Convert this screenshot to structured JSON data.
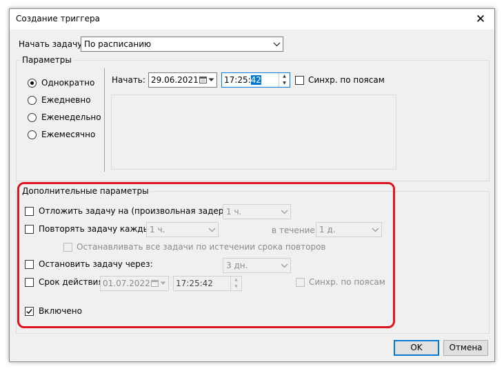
{
  "dialog": {
    "title": "Создание триггера",
    "close_glyph": "✕"
  },
  "start_task": {
    "label": "Начать задачу:",
    "value": "По расписанию"
  },
  "parameters": {
    "group_title": "Параметры",
    "options": [
      {
        "label": "Однократно",
        "selected": true
      },
      {
        "label": "Ежедневно",
        "selected": false
      },
      {
        "label": "Еженедельно",
        "selected": false
      },
      {
        "label": "Ежемесячно",
        "selected": false
      }
    ],
    "start_label": "Начать:",
    "start_date": "29.06.2021",
    "start_time_prefix": "17:25:",
    "start_time_selected": "42",
    "sync_label": "Синхр. по поясам"
  },
  "advanced": {
    "group_title": "Дополнительные параметры",
    "delay": {
      "label": "Отложить задачу на (произвольная задержка):",
      "value": "1 ч.",
      "checked": false
    },
    "repeat": {
      "label": "Повторять задачу каждые:",
      "value": "1 ч.",
      "duration_label": "в течение:",
      "duration_value": "1 д.",
      "checked": false
    },
    "stop_all": {
      "label": "Останавливать все задачи по истечении срока повторов",
      "checked": false
    },
    "stop_after": {
      "label": "Остановить задачу через:",
      "value": "3 дн.",
      "checked": false
    },
    "expire": {
      "label": "Срок действия:",
      "date": "01.07.2022",
      "time": "17:25:42",
      "sync_label": "Синхр. по поясам",
      "checked": false
    },
    "enabled": {
      "label": "Включено",
      "checked": true
    }
  },
  "buttons": {
    "ok": "OK",
    "cancel": "Отмена"
  },
  "colors": {
    "highlight": "#e0141e",
    "accent": "#0078d7"
  }
}
